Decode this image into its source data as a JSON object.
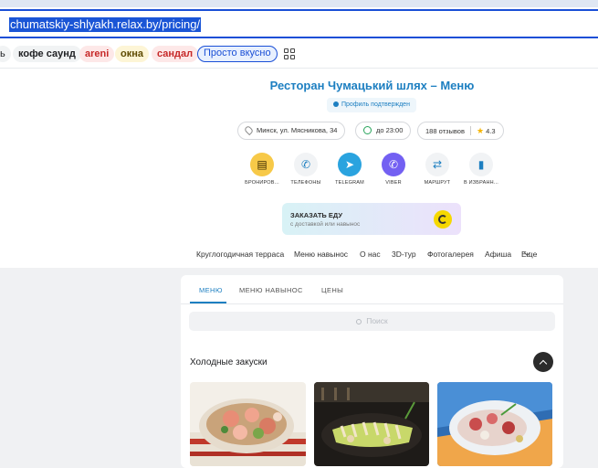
{
  "browser": {
    "url": "chumatskiy-shlyakh.relax.by/pricing/",
    "chips": [
      {
        "label": "ь",
        "style": "plain"
      },
      {
        "label": "кофе саунд",
        "style": "plain"
      },
      {
        "label": "areni",
        "style": "red"
      },
      {
        "label": "окна",
        "style": "yellow"
      },
      {
        "label": "сандал",
        "style": "red"
      },
      {
        "label": "Просто вкусно",
        "style": "blue"
      }
    ]
  },
  "restaurant": {
    "title": "Ресторан Чумацький шлях – Меню",
    "verified": "Профиль подтвержден",
    "address": "Минск, ул. Мясникова, 34",
    "hours": "до 23:00",
    "reviews": "188 отзывов",
    "rating": "4.3"
  },
  "actions": [
    {
      "label": "БРОНИРОВ...",
      "icon": "calendar-icon"
    },
    {
      "label": "ТЕЛЕФОНЫ",
      "icon": "phone-icon"
    },
    {
      "label": "TELEGRAM",
      "icon": "telegram-icon"
    },
    {
      "label": "VIBER",
      "icon": "viber-icon"
    },
    {
      "label": "МАРШРУТ",
      "icon": "route-icon"
    },
    {
      "label": "В ИЗБРАНН...",
      "icon": "bookmark-icon"
    }
  ],
  "order": {
    "title": "ЗАКАЗАТЬ ЕДУ",
    "subtitle": "с доставкой или навынос"
  },
  "nav": [
    "Круглогодичная терраса",
    "Меню навынос",
    "О нас",
    "3D-тур",
    "Фотогалерея",
    "Афиша",
    "Еще"
  ],
  "menu": {
    "tabs": [
      "МЕНЮ",
      "МЕНЮ НАВЫНОС",
      "ЦЕНЫ"
    ],
    "search_placeholder": "Поиск",
    "section": "Холодные закуски"
  },
  "colors": {
    "accent": "#1d7fc1",
    "url_selection": "#1a55d6",
    "booking": "#f7c948",
    "telegram": "#2aa3df",
    "viber": "#7360f2"
  }
}
